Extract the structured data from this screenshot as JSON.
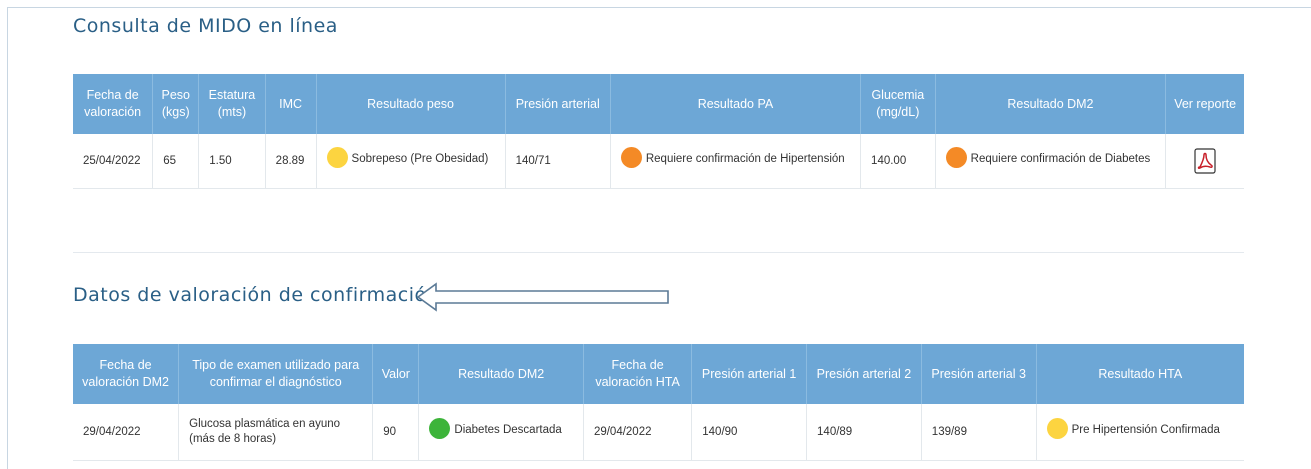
{
  "section1": {
    "title": "Consulta de MIDO en línea",
    "headers": [
      "Fecha de valoración",
      "Peso (kgs)",
      "Estatura (mts)",
      "IMC",
      "Resultado peso",
      "Presión arterial",
      "Resultado PA",
      "Glucemia (mg/dL)",
      "Resultado DM2",
      "Ver reporte"
    ],
    "row": {
      "fecha": "25/04/2022",
      "peso": "65",
      "estatura": "1.50",
      "imc": "28.89",
      "resultado_peso": {
        "label": "Sobrepeso (Pre Obesidad)",
        "color": "#fcd440"
      },
      "presion": "140/71",
      "resultado_pa": {
        "label": "Requiere confirmación de Hipertensión",
        "color": "#f48a26"
      },
      "glucemia": "140.00",
      "resultado_dm2": {
        "label": "Requiere confirmación de Diabetes",
        "color": "#f48a26"
      },
      "reporte_icon": "pdf-icon"
    }
  },
  "section2": {
    "title": "Datos de valoración de confirmación",
    "headers": [
      "Fecha de valoración DM2",
      "Tipo de examen utilizado para confirmar el diagnóstico",
      "Valor",
      "Resultado DM2",
      "Fecha de valoración HTA",
      "Presión arterial 1",
      "Presión arterial 2",
      "Presión arterial 3",
      "Resultado HTA"
    ],
    "row": {
      "fecha_dm2": "29/04/2022",
      "tipo_examen": "Glucosa plasmática en ayuno (más de 8 horas)",
      "valor": "90",
      "resultado_dm2": {
        "label": "Diabetes Descartada",
        "color": "#3db43a"
      },
      "fecha_hta": "29/04/2022",
      "pa1": "140/90",
      "pa2": "140/89",
      "pa3": "139/89",
      "resultado_hta": {
        "label": "Pre Hipertensión Confirmada",
        "color": "#fcd440"
      }
    }
  },
  "colors": {
    "header_bg": "#6da7d6",
    "title": "#2a5f86"
  }
}
